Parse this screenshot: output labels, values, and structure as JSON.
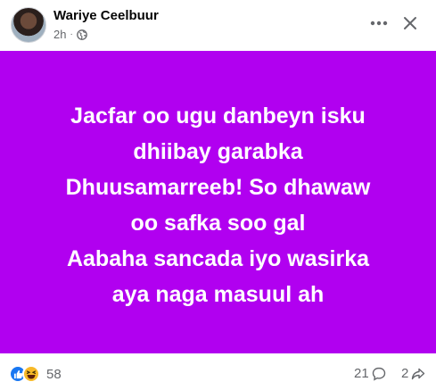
{
  "post": {
    "author": "Wariye Ceelbuur",
    "time": "2h",
    "separator": "·",
    "privacy_icon": "globe-icon",
    "text_lines": [
      "Jacfar oo ugu danbeyn isku",
      "dhiibay garabka",
      "Dhuusamarreeb! So dhawaw",
      "oo safka soo gal",
      "Aabaha sancada iyo wasirka",
      "aya naga masuul ah"
    ],
    "background_color": "#b100f0"
  },
  "footer": {
    "reaction_icons": [
      "like-icon",
      "haha-icon"
    ],
    "reaction_count": "58",
    "comment_count": "21",
    "share_count": "2"
  }
}
